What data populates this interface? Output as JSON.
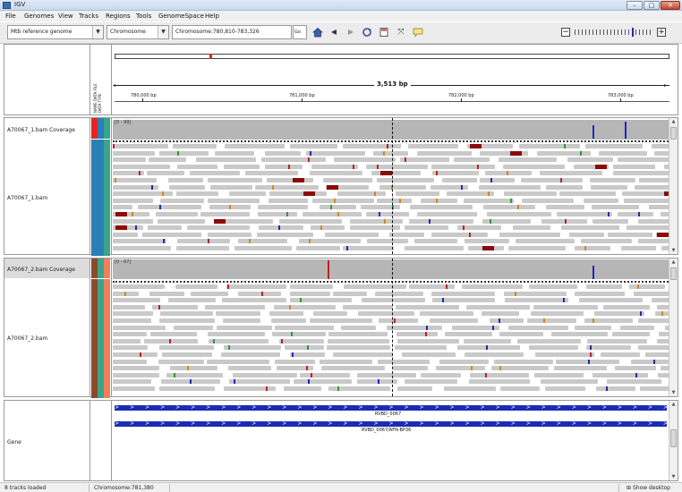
{
  "window": {
    "title": "IGV"
  },
  "menu": [
    "File",
    "Genomes",
    "View",
    "Tracks",
    "Regions",
    "Tools",
    "GenomeSpace",
    "Help"
  ],
  "toolbar": {
    "genome": "Mtb reference genome",
    "chromosome": "Chromosome",
    "locus": "Chromosome:780,810-783,326",
    "go_label": "Go"
  },
  "ruler": {
    "span_label": "3,513 bp",
    "ticks": [
      "780,000 bp",
      "781,000 bp",
      "782,000 bp",
      "783,000 bp"
    ]
  },
  "attribute_headers": [
    "NAME",
    "DATA FILE",
    "DATA TYPE"
  ],
  "tracks": {
    "cov1": {
      "name": "A70067_1.bam Coverage",
      "range": "[0 - 99]"
    },
    "bam1": {
      "name": "A70067_1.bam"
    },
    "cov2": {
      "name": "A70067_2.bam Coverage",
      "range": "[0 - 67]"
    },
    "bam2": {
      "name": "A70067_2.bam"
    },
    "gene": {
      "name": "Gene",
      "feature1": "RVBD_0067",
      "feature2": "RVBD_0067/AFN-BP36"
    }
  },
  "status": {
    "loaded": "8 tracks loaded",
    "position": "Chromosome:781,380",
    "show_desktop": "Show desktop"
  },
  "colors": {
    "attr_red": "#e8231d",
    "attr_blue": "#2a7fb6",
    "attr_teal": "#3aa58c",
    "attr_brown": "#8a4a28",
    "attr_salmon": "#f0805a",
    "gene_blue": "#1a2cb4",
    "mismatch_maroon": "#8b0a0a"
  }
}
